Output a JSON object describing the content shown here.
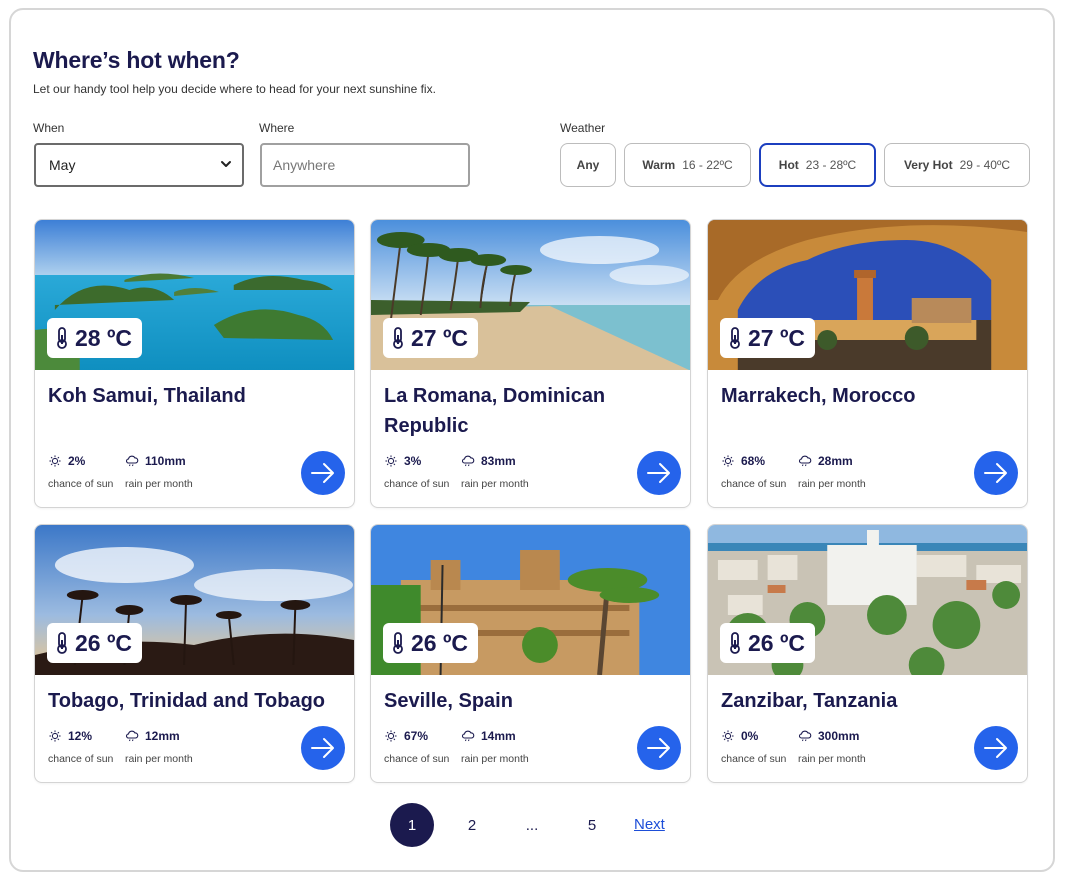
{
  "header": {
    "title": "Where’s hot when?",
    "subtitle": "Let our handy tool help you decide where to head for your next sunshine fix."
  },
  "filters": {
    "when_label": "When",
    "when_value": "May",
    "where_label": "Where",
    "where_placeholder": "Anywhere",
    "weather_label": "Weather",
    "weather_options": [
      {
        "name": "Any",
        "range": ""
      },
      {
        "name": "Warm",
        "range": "16 - 22ºC"
      },
      {
        "name": "Hot",
        "range": "23 - 28ºC"
      },
      {
        "name": "Very Hot",
        "range": "29 - 40ºC"
      }
    ],
    "weather_selected": "Hot"
  },
  "cards": [
    {
      "temp": "28 ºC",
      "name": "Koh Samui, Thailand",
      "sun": "2%",
      "sun_label": "chance of sun",
      "rain": "110mm",
      "rain_label": "rain per month"
    },
    {
      "temp": "27 ºC",
      "name": "La Romana, Dominican Republic",
      "sun": "3%",
      "sun_label": "chance of sun",
      "rain": "83mm",
      "rain_label": "rain per month"
    },
    {
      "temp": "27 ºC",
      "name": "Marrakech, Morocco",
      "sun": "68%",
      "sun_label": "chance of sun",
      "rain": "28mm",
      "rain_label": "rain per month"
    },
    {
      "temp": "26 ºC",
      "name": "Tobago, Trinidad and Tobago",
      "sun": "12%",
      "sun_label": "chance of sun",
      "rain": "12mm",
      "rain_label": "rain per month"
    },
    {
      "temp": "26 ºC",
      "name": "Seville, Spain",
      "sun": "67%",
      "sun_label": "chance of sun",
      "rain": "14mm",
      "rain_label": "rain per month"
    },
    {
      "temp": "26 ºC",
      "name": "Zanzibar, Tanzania",
      "sun": "0%",
      "sun_label": "chance of sun",
      "rain": "300mm",
      "rain_label": "rain per month"
    }
  ],
  "pagination": {
    "pages": [
      "1",
      "2",
      "...",
      "5"
    ],
    "current": "1",
    "next_label": "Next"
  },
  "icons": {
    "chevron": "chevron-down-icon",
    "thermometer": "thermometer-icon",
    "sun": "sun-icon",
    "rain": "rain-cloud-icon",
    "arrow": "arrow-right-icon"
  },
  "colors": {
    "navy": "#1b1a4e",
    "accent_blue": "#2563eb",
    "selected_border": "#1c3fbf",
    "link": "#1d4ed8"
  }
}
